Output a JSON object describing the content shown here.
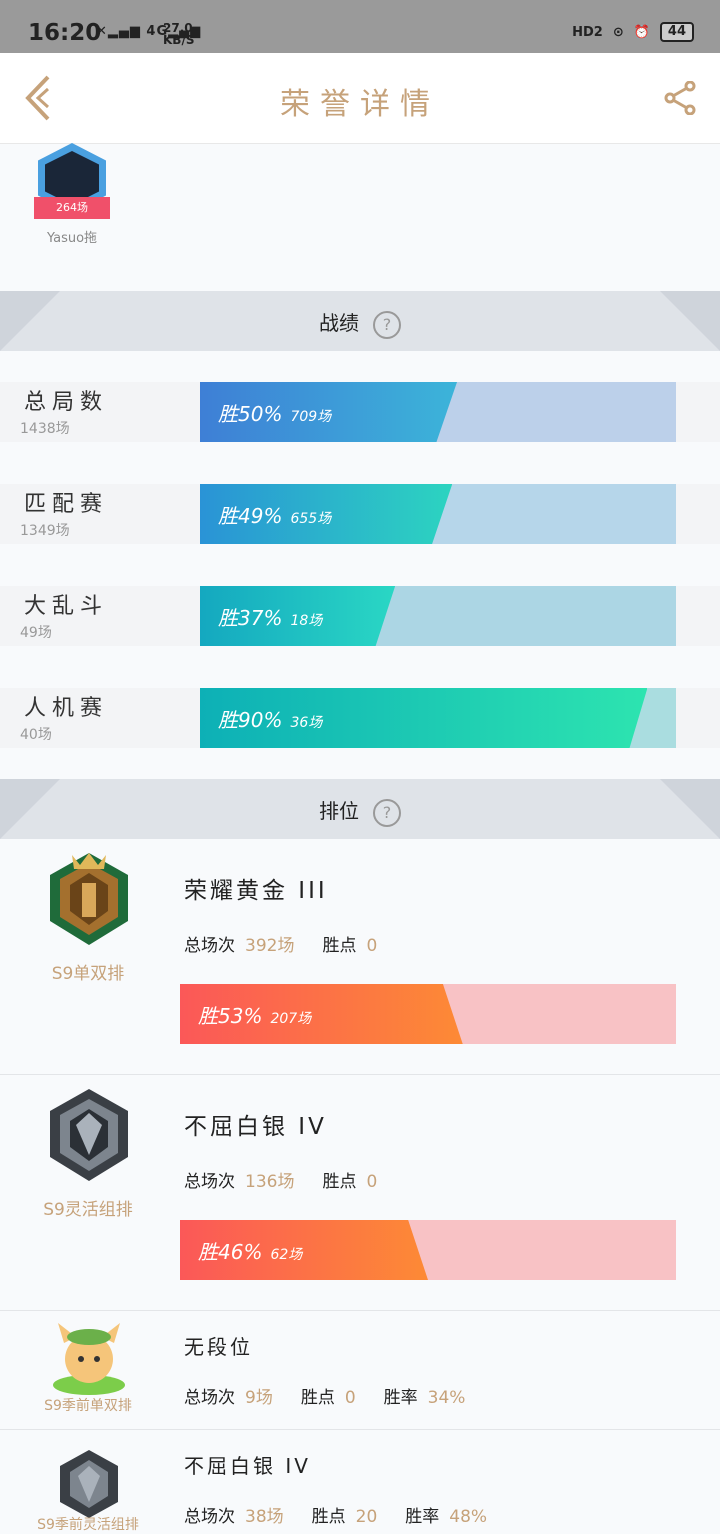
{
  "status_bar": {
    "time": "16:20",
    "network": "4G",
    "speed": "27.0",
    "speed_unit": "KB/S",
    "battery": "44",
    "hd": "HD2"
  },
  "header": {
    "title": "荣誉详情"
  },
  "champion": {
    "games": "264场",
    "name": "Yasuo拖"
  },
  "record_section": {
    "title": "战绩"
  },
  "records": [
    {
      "name": "总局数",
      "count": "1438场",
      "winrate": "胜50%",
      "games": "709场",
      "win_fraction": 0.5
    },
    {
      "name": "匹配赛",
      "count": "1349场",
      "winrate": "胜49%",
      "games": "655场",
      "win_fraction": 0.49
    },
    {
      "name": "大乱斗",
      "count": "49场",
      "winrate": "胜37%",
      "games": "18场",
      "win_fraction": 0.37
    },
    {
      "name": "人机赛",
      "count": "40场",
      "winrate": "胜90%",
      "games": "36场",
      "win_fraction": 0.9
    }
  ],
  "rank_section": {
    "title": "排位"
  },
  "ranks": [
    {
      "tier": "荣耀黄金 III",
      "queue": "S9单双排",
      "total_label": "总场次",
      "total": "392场",
      "points_label": "胜点",
      "points": "0",
      "winrate": "胜53%",
      "games": "207场",
      "win_fraction": 0.53
    },
    {
      "tier": "不屈白银 IV",
      "queue": "S9灵活组排",
      "total_label": "总场次",
      "total": "136场",
      "points_label": "胜点",
      "points": "0",
      "winrate": "胜46%",
      "games": "62场",
      "win_fraction": 0.46
    },
    {
      "tier": "无段位",
      "queue": "S9季前单双排",
      "total_label": "总场次",
      "total": "9场",
      "points_label": "胜点",
      "points": "0",
      "rate_label": "胜率",
      "rate": "34%"
    },
    {
      "tier": "不屈白银 IV",
      "queue": "S9季前灵活组排",
      "total_label": "总场次",
      "total": "38场",
      "points_label": "胜点",
      "points": "20",
      "rate_label": "胜率",
      "rate": "48%"
    }
  ],
  "colors": {
    "accent": "#c6a27a",
    "rank_bar": "#fb5858",
    "rank_bar_bg": "#f8c2c5"
  }
}
